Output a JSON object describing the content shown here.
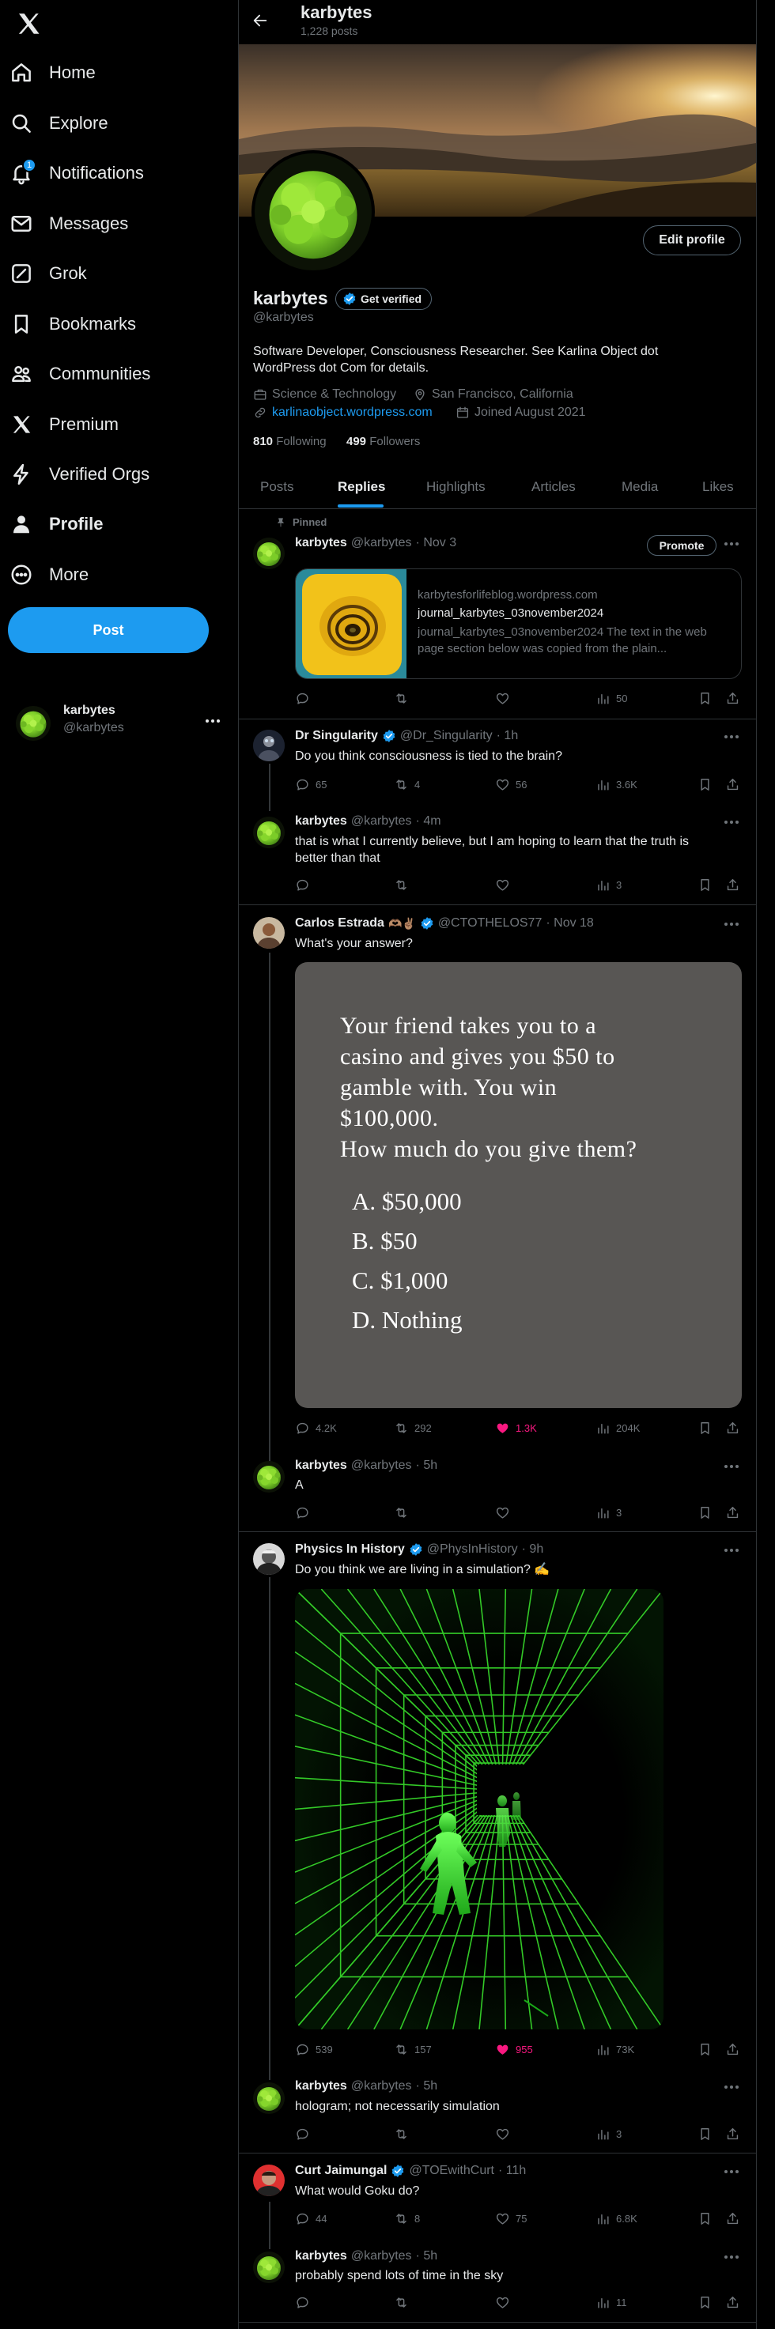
{
  "nav": {
    "logo": "X",
    "items": [
      {
        "label": "Home",
        "icon": "home-icon"
      },
      {
        "label": "Explore",
        "icon": "search-icon"
      },
      {
        "label": "Notifications",
        "icon": "bell-icon",
        "badge": "1"
      },
      {
        "label": "Messages",
        "icon": "envelope-icon"
      },
      {
        "label": "Grok",
        "icon": "grok-icon"
      },
      {
        "label": "Bookmarks",
        "icon": "bookmark-icon"
      },
      {
        "label": "Communities",
        "icon": "people-icon"
      },
      {
        "label": "Premium",
        "icon": "x-logo-icon"
      },
      {
        "label": "Verified Orgs",
        "icon": "lightning-icon"
      },
      {
        "label": "Profile",
        "icon": "person-icon"
      },
      {
        "label": "More",
        "icon": "more-circle-icon"
      }
    ],
    "post_button": "Post",
    "account": {
      "name": "karbytes",
      "handle": "@karbytes"
    }
  },
  "header": {
    "title": "karbytes",
    "subtitle": "1,228 posts"
  },
  "profile": {
    "name": "karbytes",
    "get_verified": "Get verified",
    "handle": "@karbytes",
    "bio_line1": "Software Developer, Consciousness Researcher. See Karlina Object dot",
    "bio_line2": "WordPress dot Com for details.",
    "category": "Science & Technology",
    "location": "San Francisco, California",
    "link": "karlinaobject.wordpress.com",
    "joined": "Joined August 2021",
    "following_count": "810",
    "following_label": "Following",
    "followers_count": "499",
    "followers_label": "Followers",
    "edit_button": "Edit profile"
  },
  "tabs": [
    "Posts",
    "Replies",
    "Highlights",
    "Articles",
    "Media",
    "Likes"
  ],
  "active_tab": "Replies",
  "posts": {
    "pinned": {
      "pinned_label": "Pinned",
      "name": "karbytes",
      "handle": "@karbytes",
      "time": "· Nov 3",
      "promote": "Promote",
      "card": {
        "domain": "karbytesforlifeblog.wordpress.com",
        "title": "journal_karbytes_03november2024",
        "desc": "journal_karbytes_03november2024 The text in the web page section below was copied from the plain..."
      },
      "views": "50"
    },
    "drsing": {
      "name": "Dr Singularity",
      "handle": "@Dr_Singularity",
      "time": "· 1h",
      "text": "Do you think consciousness is tied to the brain?",
      "replies": "65",
      "reposts": "4",
      "likes": "56",
      "views": "3.6K"
    },
    "reply1": {
      "name": "karbytes",
      "handle": "@karbytes",
      "time": "· 4m",
      "text_line1": "that is what I currently believe, but I am hoping to learn that the truth is",
      "text_line2": "better than that",
      "views": "3"
    },
    "carlos": {
      "name": "Carlos Estrada",
      "emoji": "🫶🏽✌🏽",
      "handle": "@CTOTHELOS77",
      "time": "· Nov 18",
      "text": "What's your answer?",
      "image": {
        "line1": "Your friend takes you to a",
        "line2": "casino and gives you $50 to",
        "line3": "gamble with.  You win",
        "line4": "$100,000.",
        "line5": "How much do you give them?",
        "optA": "A. $50,000",
        "optB": "B. $50",
        "optC": "C. $1,000",
        "optD": "D. Nothing"
      },
      "replies": "4.2K",
      "reposts": "292",
      "likes": "1.3K",
      "views": "204K"
    },
    "reply2": {
      "name": "karbytes",
      "handle": "@karbytes",
      "time": "· 5h",
      "text": "A",
      "views": "3"
    },
    "physics": {
      "name": "Physics In History",
      "handle": "@PhysInHistory",
      "time": "· 9h",
      "text": "Do you think we are living in a simulation? ✍️",
      "replies": "539",
      "reposts": "157",
      "likes": "955",
      "views": "73K"
    },
    "reply3": {
      "name": "karbytes",
      "handle": "@karbytes",
      "time": "· 5h",
      "text": "hologram; not necessarily simulation",
      "views": "3"
    },
    "curt": {
      "name": "Curt Jaimungal",
      "handle": "@TOEwithCurt",
      "time": "· 11h",
      "text": "What would Goku do?",
      "replies": "44",
      "reposts": "8",
      "likes": "75",
      "views": "6.8K"
    },
    "reply4": {
      "name": "karbytes",
      "handle": "@karbytes",
      "time": "· 5h",
      "text": "probably spend lots of time in the sky",
      "views": "11"
    }
  },
  "colors": {
    "accent": "#1d9bf0",
    "like": "#f91880",
    "verified": "#1d9bf0",
    "bg": "#000000",
    "border": "#2f3336",
    "muted": "#71767b",
    "text": "#e7e9ea"
  }
}
